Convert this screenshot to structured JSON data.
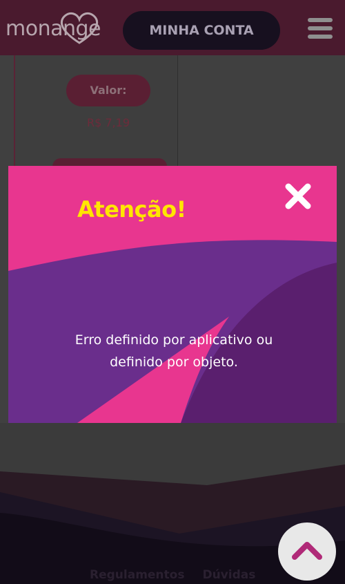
{
  "header": {
    "logo_text": "monange",
    "account_label": "MINHA CONTA"
  },
  "card": {
    "value_label": "Valor:",
    "price": "R$ 7,19"
  },
  "modal": {
    "title": "Atenção!",
    "message_line1": "Erro definido por aplicativo ou",
    "message_line2": "definido por objeto."
  },
  "footer": {
    "links": [
      "Regulamentos",
      "Dúvidas"
    ]
  },
  "colors": {
    "modal_pink": "#e8368f",
    "modal_purple": "#6a2e8c",
    "title_yellow": "#ffe600",
    "header_bg": "#4a1a2e"
  },
  "icons": [
    "heart-icon",
    "menu-icon",
    "close-icon",
    "chevron-up-icon"
  ]
}
